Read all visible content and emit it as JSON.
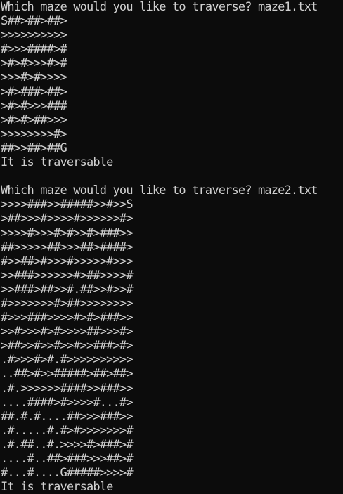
{
  "console": {
    "runs": [
      {
        "prompt": "Which maze would you like to traverse? maze1.txt",
        "maze_rows": [
          "S##>##>##>",
          ">>>>>>>>>>",
          "#>>>####>#",
          ">#>#>>>#>#",
          ">>>#>#>>>>",
          ">#>###>##>",
          ">#>#>>>###",
          ">#>#>##>>>",
          ">>>>>>>>#>",
          "##>>##>##G"
        ],
        "result": "It is traversable"
      },
      {
        "prompt": "Which maze would you like to traverse? maze2.txt",
        "maze_rows": [
          ">>>>###>>#####>>#>>S",
          ">##>>>#>>>>#>>>>>>#>",
          ">>>>#>>>#>#>>#>###>>",
          "##>>>>>##>>>##>####>",
          "#>>##>#>>>#>>>>>#>>>",
          ">>###>>>>>>#>##>>>>#",
          ">>###>##>>#.##>>#>>#",
          "#>>>>>>>#>##>>>>>>>>",
          "#>>>###>>>>#>#>###>>",
          ">>#>>>#>#>>>>##>>>#>",
          ">##>>#>>#>>#>>###>#>",
          ".#>>>#>#.#>>>>>>>>>>",
          "..##>#>>#####>##>##>",
          ".#.>>>>>>####>>###>>",
          "....####>#>>>>#...#>",
          "##.#.#....##>>>###>>",
          ".#.....#.#>#>>>>>>>#",
          ".#.##..#.>>>>#>###>#",
          "....#..##>###>>>##>#",
          "#...#....G#####>>>>#"
        ],
        "result": "It is traversable"
      }
    ]
  }
}
